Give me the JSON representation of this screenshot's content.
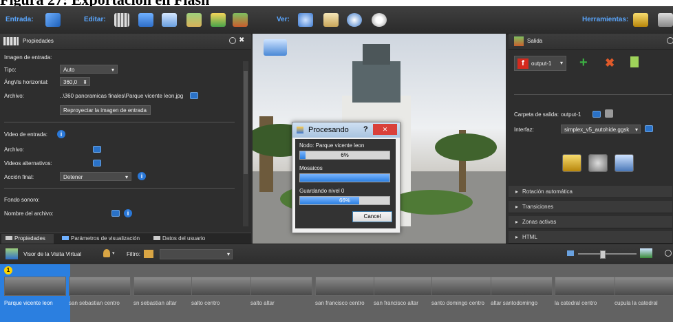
{
  "doc_title": "Figura 27: Exportación en Flash",
  "toolbar": {
    "entrada_label": "Entrada:",
    "editar_label": "Editar:",
    "ver_label": "Ver:",
    "herramientas_label": "Herramientas:"
  },
  "props": {
    "title": "Propiedades",
    "imagen_entrada": "Imagen de entrada:",
    "tipo_label": "Tipo:",
    "tipo_value": "Auto",
    "angvis_label": "ÁngVis horizontal:",
    "angvis_value": "360,0",
    "archivo_label": "Archivo:",
    "archivo_value": "..\\360 panoramicas finales\\Parque vicente leon.jpg",
    "reproyectar_button": "Reproyectar la imagen de entrada",
    "video_label": "Video de entrada:",
    "video_archivo_label": "Archivo:",
    "videos_alt_label": "Videos alternativos:",
    "accion_final_label": "Acción final:",
    "accion_final_value": "Detener",
    "fondo_label": "Fondo sonoro:",
    "nombre_archivo_label": "Nombre del archivo:"
  },
  "bottom_tabs": [
    "Propiedades",
    "Parámetros de visualización",
    "Datos del usuario"
  ],
  "output": {
    "title": "Salida",
    "output_select": "output-1",
    "carpeta_label": "Carpeta de salida:",
    "carpeta_value": "output-1",
    "interfaz_label": "Interfaz:",
    "interfaz_value": "simplex_v5_autohide.ggsk",
    "accordion": [
      "Rotación automática",
      "Transiciones",
      "Zonas activas",
      "HTML"
    ]
  },
  "dialog": {
    "title": "Procesando",
    "help_glyph": "?",
    "close_glyph": "✕",
    "node_label": "Nodo: Parque vicente leon",
    "node_progress": 6,
    "node_progress_text": "6%",
    "mosaicos_label": "Mosaicos",
    "mosaicos_progress": 100,
    "guardando_label": "Guardando nivel 0",
    "guardando_progress": 66,
    "guardando_progress_text": "66%",
    "cancel_button": "Cancel"
  },
  "tour_bar": {
    "title": "Visor de la Visita Virtual",
    "filtro_label": "Filtro:"
  },
  "thumbnails": [
    {
      "label": "Parque vicente leon",
      "badge": "1"
    },
    {
      "label": "san sebastian centro"
    },
    {
      "label": "sn sebastian altar"
    },
    {
      "label": "salto centro"
    },
    {
      "label": "salto altar"
    },
    {
      "label": "san francisco centro"
    },
    {
      "label": "san francisco altar"
    },
    {
      "label": "santo domingo centro"
    },
    {
      "label": "altar santodomingo"
    },
    {
      "label": "la catedral centro"
    },
    {
      "label": "cupula la catedral"
    }
  ],
  "colors": {
    "accent": "#5aa7ff",
    "selected_thumb": "#2b7fe0",
    "progress": "#2b7fe0"
  }
}
